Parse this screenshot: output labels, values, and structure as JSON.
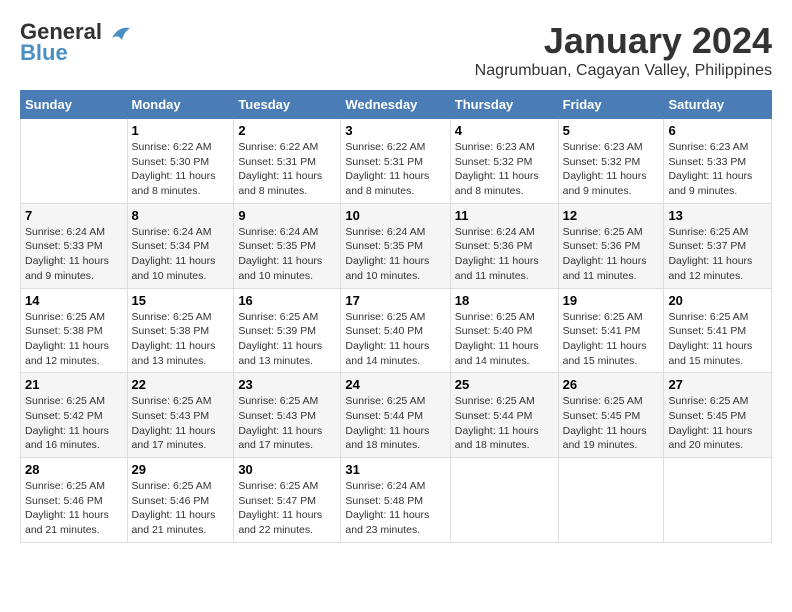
{
  "header": {
    "logo_general": "General",
    "logo_blue": "Blue",
    "month_title": "January 2024",
    "location": "Nagrumbuan, Cagayan Valley, Philippines"
  },
  "columns": [
    "Sunday",
    "Monday",
    "Tuesday",
    "Wednesday",
    "Thursday",
    "Friday",
    "Saturday"
  ],
  "weeks": [
    [
      {
        "day": "",
        "sunrise": "",
        "sunset": "",
        "daylight": ""
      },
      {
        "day": "1",
        "sunrise": "Sunrise: 6:22 AM",
        "sunset": "Sunset: 5:30 PM",
        "daylight": "Daylight: 11 hours and 8 minutes."
      },
      {
        "day": "2",
        "sunrise": "Sunrise: 6:22 AM",
        "sunset": "Sunset: 5:31 PM",
        "daylight": "Daylight: 11 hours and 8 minutes."
      },
      {
        "day": "3",
        "sunrise": "Sunrise: 6:22 AM",
        "sunset": "Sunset: 5:31 PM",
        "daylight": "Daylight: 11 hours and 8 minutes."
      },
      {
        "day": "4",
        "sunrise": "Sunrise: 6:23 AM",
        "sunset": "Sunset: 5:32 PM",
        "daylight": "Daylight: 11 hours and 8 minutes."
      },
      {
        "day": "5",
        "sunrise": "Sunrise: 6:23 AM",
        "sunset": "Sunset: 5:32 PM",
        "daylight": "Daylight: 11 hours and 9 minutes."
      },
      {
        "day": "6",
        "sunrise": "Sunrise: 6:23 AM",
        "sunset": "Sunset: 5:33 PM",
        "daylight": "Daylight: 11 hours and 9 minutes."
      }
    ],
    [
      {
        "day": "7",
        "sunrise": "Sunrise: 6:24 AM",
        "sunset": "Sunset: 5:33 PM",
        "daylight": "Daylight: 11 hours and 9 minutes."
      },
      {
        "day": "8",
        "sunrise": "Sunrise: 6:24 AM",
        "sunset": "Sunset: 5:34 PM",
        "daylight": "Daylight: 11 hours and 10 minutes."
      },
      {
        "day": "9",
        "sunrise": "Sunrise: 6:24 AM",
        "sunset": "Sunset: 5:35 PM",
        "daylight": "Daylight: 11 hours and 10 minutes."
      },
      {
        "day": "10",
        "sunrise": "Sunrise: 6:24 AM",
        "sunset": "Sunset: 5:35 PM",
        "daylight": "Daylight: 11 hours and 10 minutes."
      },
      {
        "day": "11",
        "sunrise": "Sunrise: 6:24 AM",
        "sunset": "Sunset: 5:36 PM",
        "daylight": "Daylight: 11 hours and 11 minutes."
      },
      {
        "day": "12",
        "sunrise": "Sunrise: 6:25 AM",
        "sunset": "Sunset: 5:36 PM",
        "daylight": "Daylight: 11 hours and 11 minutes."
      },
      {
        "day": "13",
        "sunrise": "Sunrise: 6:25 AM",
        "sunset": "Sunset: 5:37 PM",
        "daylight": "Daylight: 11 hours and 12 minutes."
      }
    ],
    [
      {
        "day": "14",
        "sunrise": "Sunrise: 6:25 AM",
        "sunset": "Sunset: 5:38 PM",
        "daylight": "Daylight: 11 hours and 12 minutes."
      },
      {
        "day": "15",
        "sunrise": "Sunrise: 6:25 AM",
        "sunset": "Sunset: 5:38 PM",
        "daylight": "Daylight: 11 hours and 13 minutes."
      },
      {
        "day": "16",
        "sunrise": "Sunrise: 6:25 AM",
        "sunset": "Sunset: 5:39 PM",
        "daylight": "Daylight: 11 hours and 13 minutes."
      },
      {
        "day": "17",
        "sunrise": "Sunrise: 6:25 AM",
        "sunset": "Sunset: 5:40 PM",
        "daylight": "Daylight: 11 hours and 14 minutes."
      },
      {
        "day": "18",
        "sunrise": "Sunrise: 6:25 AM",
        "sunset": "Sunset: 5:40 PM",
        "daylight": "Daylight: 11 hours and 14 minutes."
      },
      {
        "day": "19",
        "sunrise": "Sunrise: 6:25 AM",
        "sunset": "Sunset: 5:41 PM",
        "daylight": "Daylight: 11 hours and 15 minutes."
      },
      {
        "day": "20",
        "sunrise": "Sunrise: 6:25 AM",
        "sunset": "Sunset: 5:41 PM",
        "daylight": "Daylight: 11 hours and 15 minutes."
      }
    ],
    [
      {
        "day": "21",
        "sunrise": "Sunrise: 6:25 AM",
        "sunset": "Sunset: 5:42 PM",
        "daylight": "Daylight: 11 hours and 16 minutes."
      },
      {
        "day": "22",
        "sunrise": "Sunrise: 6:25 AM",
        "sunset": "Sunset: 5:43 PM",
        "daylight": "Daylight: 11 hours and 17 minutes."
      },
      {
        "day": "23",
        "sunrise": "Sunrise: 6:25 AM",
        "sunset": "Sunset: 5:43 PM",
        "daylight": "Daylight: 11 hours and 17 minutes."
      },
      {
        "day": "24",
        "sunrise": "Sunrise: 6:25 AM",
        "sunset": "Sunset: 5:44 PM",
        "daylight": "Daylight: 11 hours and 18 minutes."
      },
      {
        "day": "25",
        "sunrise": "Sunrise: 6:25 AM",
        "sunset": "Sunset: 5:44 PM",
        "daylight": "Daylight: 11 hours and 18 minutes."
      },
      {
        "day": "26",
        "sunrise": "Sunrise: 6:25 AM",
        "sunset": "Sunset: 5:45 PM",
        "daylight": "Daylight: 11 hours and 19 minutes."
      },
      {
        "day": "27",
        "sunrise": "Sunrise: 6:25 AM",
        "sunset": "Sunset: 5:45 PM",
        "daylight": "Daylight: 11 hours and 20 minutes."
      }
    ],
    [
      {
        "day": "28",
        "sunrise": "Sunrise: 6:25 AM",
        "sunset": "Sunset: 5:46 PM",
        "daylight": "Daylight: 11 hours and 21 minutes."
      },
      {
        "day": "29",
        "sunrise": "Sunrise: 6:25 AM",
        "sunset": "Sunset: 5:46 PM",
        "daylight": "Daylight: 11 hours and 21 minutes."
      },
      {
        "day": "30",
        "sunrise": "Sunrise: 6:25 AM",
        "sunset": "Sunset: 5:47 PM",
        "daylight": "Daylight: 11 hours and 22 minutes."
      },
      {
        "day": "31",
        "sunrise": "Sunrise: 6:24 AM",
        "sunset": "Sunset: 5:48 PM",
        "daylight": "Daylight: 11 hours and 23 minutes."
      },
      {
        "day": "",
        "sunrise": "",
        "sunset": "",
        "daylight": ""
      },
      {
        "day": "",
        "sunrise": "",
        "sunset": "",
        "daylight": ""
      },
      {
        "day": "",
        "sunrise": "",
        "sunset": "",
        "daylight": ""
      }
    ]
  ]
}
